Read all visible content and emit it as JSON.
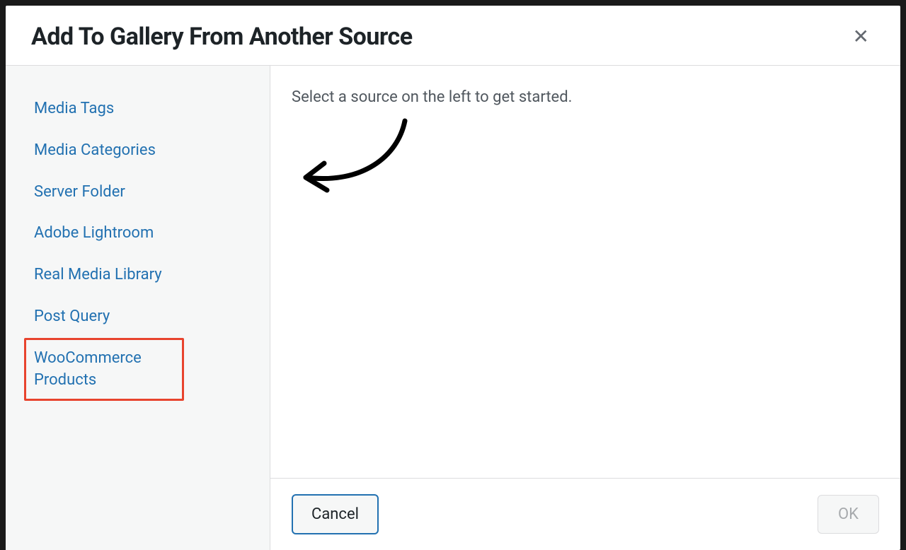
{
  "modal": {
    "title": "Add To Gallery From Another Source",
    "close_icon": "✕"
  },
  "sidebar": {
    "items": [
      {
        "label": "Media Tags",
        "highlighted": false
      },
      {
        "label": "Media Categories",
        "highlighted": false
      },
      {
        "label": "Server Folder",
        "highlighted": false
      },
      {
        "label": "Adobe Lightroom",
        "highlighted": false
      },
      {
        "label": "Real Media Library",
        "highlighted": false
      },
      {
        "label": "Post Query",
        "highlighted": false
      },
      {
        "label": "WooCommerce Products",
        "highlighted": true
      }
    ]
  },
  "content": {
    "instruction": "Select a source on the left to get started."
  },
  "footer": {
    "cancel_label": "Cancel",
    "ok_label": "OK"
  }
}
